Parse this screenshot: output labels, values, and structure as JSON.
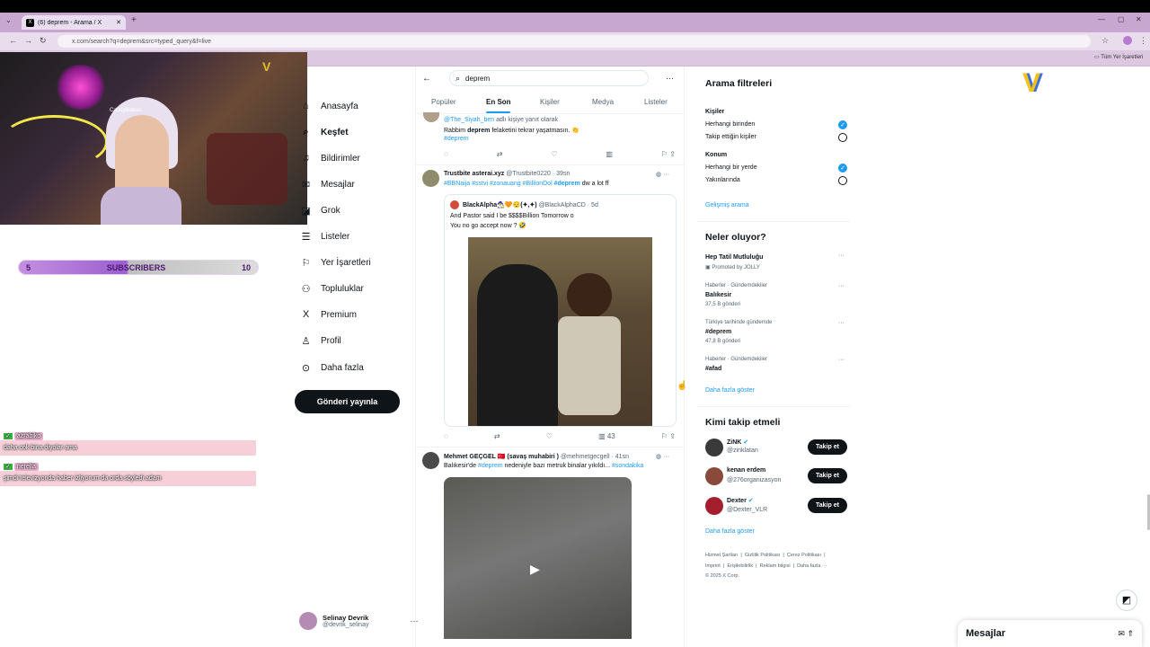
{
  "browser": {
    "tab_title": "(6) deprem - Arama / X",
    "url": "x.com/search?q=deprem&src=typed_query&f=live",
    "bookmark_folder": "Tüm Yer İşaretleri"
  },
  "stream": {
    "webcam_name": "CandyBabies",
    "sub_goal": {
      "current": "5",
      "label": "SUBSCRIBERS",
      "target": "10",
      "progress": 0.5
    },
    "chat": [
      {
        "user": "azrabiko",
        "message": "daha cok bina diyolar ama"
      },
      {
        "user": "nerella",
        "message": "şimdi televizyonda haber izliyorum da orda söyledi adam"
      }
    ]
  },
  "nav": {
    "items": [
      {
        "label": "Anasayfa",
        "icon": "home-icon"
      },
      {
        "label": "Keşfet",
        "icon": "search-icon"
      },
      {
        "label": "Bildirimler",
        "icon": "bell-icon"
      },
      {
        "label": "Mesajlar",
        "icon": "mail-icon"
      },
      {
        "label": "Grok",
        "icon": "grok-icon"
      },
      {
        "label": "Listeler",
        "icon": "list-icon"
      },
      {
        "label": "Yer İşaretleri",
        "icon": "bookmark-icon"
      },
      {
        "label": "Topluluklar",
        "icon": "people-icon"
      },
      {
        "label": "Premium",
        "icon": "x-logo-icon"
      },
      {
        "label": "Profil",
        "icon": "user-icon"
      },
      {
        "label": "Daha fazla",
        "icon": "more-circle-icon"
      }
    ],
    "post_button": "Gönderi yayınla",
    "account": {
      "name": "Selinay Devrik",
      "handle": "@devrik_selinay"
    }
  },
  "search": {
    "query": "deprem",
    "tabs": [
      "Popüler",
      "En Son",
      "Kişiler",
      "Medya",
      "Listeler"
    ],
    "active_tab": "En Son"
  },
  "tweets": [
    {
      "reply_to": "@The_Siyah_ben",
      "reply_suffix": " adlı kişiye yanıt olarak",
      "text_pre": "Rabbim ",
      "text_bold": "deprem",
      "text_post": " felaketini tekrar yaşatmasın. 👏",
      "hashtag": "#deprem"
    },
    {
      "name": "Trustbite asterai.xyz",
      "handle": "@Trustbite0220",
      "time": "39sn",
      "hashtags": "#BBNaija #sstvi #zonauang #BillionDol",
      "hashtag2": "#deprem",
      "suffix": "dw a lot ff",
      "quote": {
        "name": "BlackAlpha🧙‍♂️🧡😌(✦,✦)",
        "handle": "@BlackAlphaCD",
        "time": "5d",
        "line1": "And Pastor said I be $$$$Billion Tomorrow o",
        "line2": "You no go accept now ? 🤣"
      },
      "views": "43"
    },
    {
      "name": "Mehmet GEÇGEL 🇹🇷 (savaş muhabiri )",
      "handle": "@mehmetgecgell",
      "time": "41sn",
      "text_pre": "Balıkesir'de ",
      "hashtag": "#deprem",
      "text_post": " nedeniyle bazı metruk binalar yıkıldı...",
      "hashtag2": "#sondakika"
    }
  ],
  "filters": {
    "title": "Arama filtreleri",
    "people_title": "Kişiler",
    "people": [
      {
        "label": "Herhangi birinden",
        "on": true
      },
      {
        "label": "Takip ettiğin kişiler",
        "on": false
      }
    ],
    "location_title": "Konum",
    "location": [
      {
        "label": "Herhangi bir yerde",
        "on": true
      },
      {
        "label": "Yakınlarında",
        "on": false
      }
    ],
    "advanced": "Gelişmiş arama"
  },
  "trends": {
    "title": "Neler oluyor?",
    "items": [
      {
        "context": "",
        "name": "Hep Tatil Mutluluğu",
        "meta": "Promoted by JOLLY"
      },
      {
        "context": "Haberler · Gündemdekiler",
        "name": "Balıkesir",
        "meta": "37,5 B gönderi"
      },
      {
        "context": "Türkiye tarihinde gündemde",
        "name": "#deprem",
        "meta": "47,8 B gönderi"
      },
      {
        "context": "Haberler · Gündemdekiler",
        "name": "#afad",
        "meta": ""
      }
    ],
    "show_more": "Daha fazla göster"
  },
  "who_to_follow": {
    "title": "Kimi takip etmeli",
    "items": [
      {
        "name": "ZiNK",
        "handle": "@zinklatan",
        "button": "Takip et"
      },
      {
        "name": "kenan erdem",
        "handle": "@276organizasyon",
        "button": "Takip et"
      },
      {
        "name": "Dexter",
        "handle": "@Dexter_VLR",
        "button": "Takip et"
      }
    ],
    "show_more": "Daha fazla göster"
  },
  "footer": {
    "line1": "Hizmet Şartları  |  Gizlilik Politikası  |  Çerez Politikası  |",
    "line2": "Imprint  |  Erişilebilirlik  |  Reklam bilgisi  |  Daha fazla ···",
    "line3": "© 2025 X Corp."
  },
  "messages_drawer": {
    "label": "Mesajlar"
  }
}
